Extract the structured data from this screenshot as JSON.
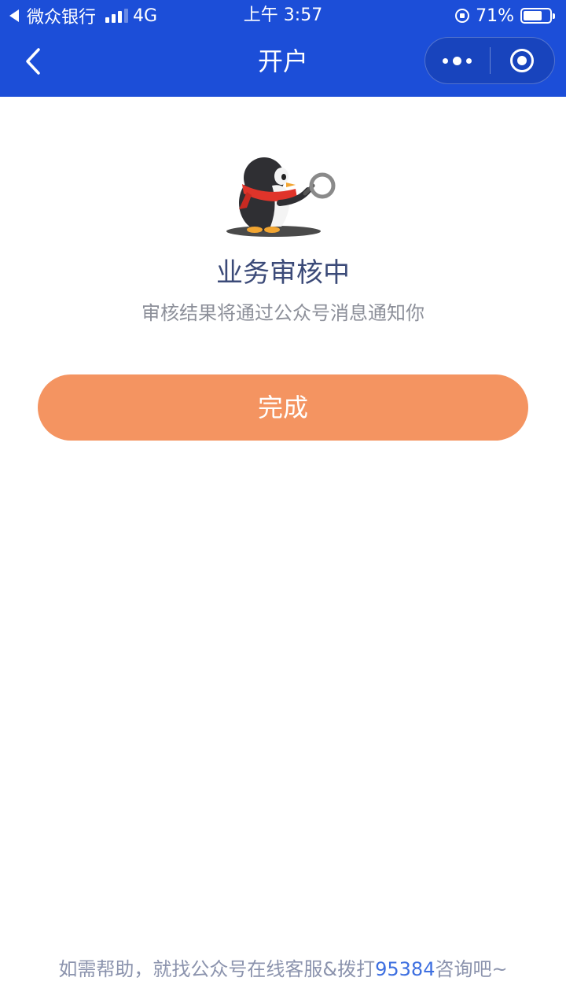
{
  "status_bar": {
    "back_app": "微众银行",
    "network": "4G",
    "time": "上午 3:57",
    "battery": "71%",
    "battery_level": 0.71,
    "signal_bars": 3
  },
  "nav": {
    "title": "开户"
  },
  "colors": {
    "header_bg": "#1c4ed8",
    "primary_button": "#f49461",
    "title_text": "#3b4a78",
    "link": "#3d6fe0"
  },
  "result": {
    "title": "业务审核中",
    "description": "审核结果将通过公众号消息通知你"
  },
  "actions": {
    "done_label": "完成"
  },
  "footer": {
    "help_prefix": "如需帮助，就找公众号在线客服&拨打",
    "phone": "95384",
    "help_suffix": "咨询吧~"
  },
  "icons": {
    "back": "chevron-left-icon",
    "more": "more-dots-icon",
    "close": "target-circle-icon",
    "mascot": "penguin-magnifier-illustration"
  }
}
